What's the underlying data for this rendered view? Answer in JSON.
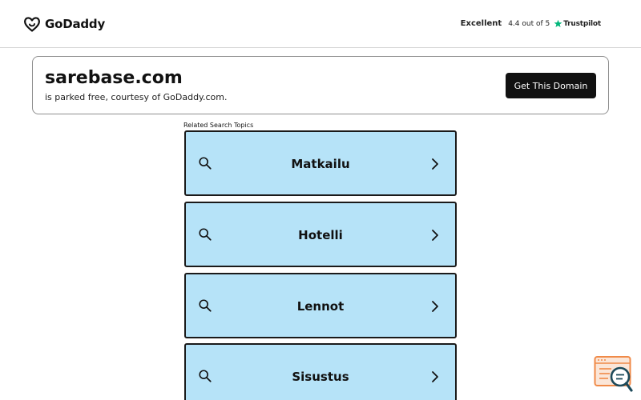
{
  "header": {
    "logo_text": "GoDaddy",
    "rating": {
      "label": "Excellent",
      "score_text": "4.4 out of 5",
      "brand": "Trustpilot",
      "star_color": "#00b67a"
    }
  },
  "domain_card": {
    "domain": "sarebase.com",
    "subtitle": "is parked free, courtesy of GoDaddy.com.",
    "cta_label": "Get This Domain"
  },
  "related": {
    "heading": "Related Search Topics",
    "topics": [
      {
        "label": "Matkailu"
      },
      {
        "label": "Hotelli"
      },
      {
        "label": "Lennot"
      },
      {
        "label": "Sisustus"
      }
    ]
  },
  "colors": {
    "topic_bg": "#b6e3f8",
    "cta_bg": "#111111",
    "widget_accent": "#f08a48"
  },
  "icons": {
    "logo": "godaddy-logo-icon",
    "star": "trustpilot-star-icon",
    "search": "search-icon",
    "chevron": "chevron-right-icon",
    "widget": "chat-search-widget-icon"
  }
}
